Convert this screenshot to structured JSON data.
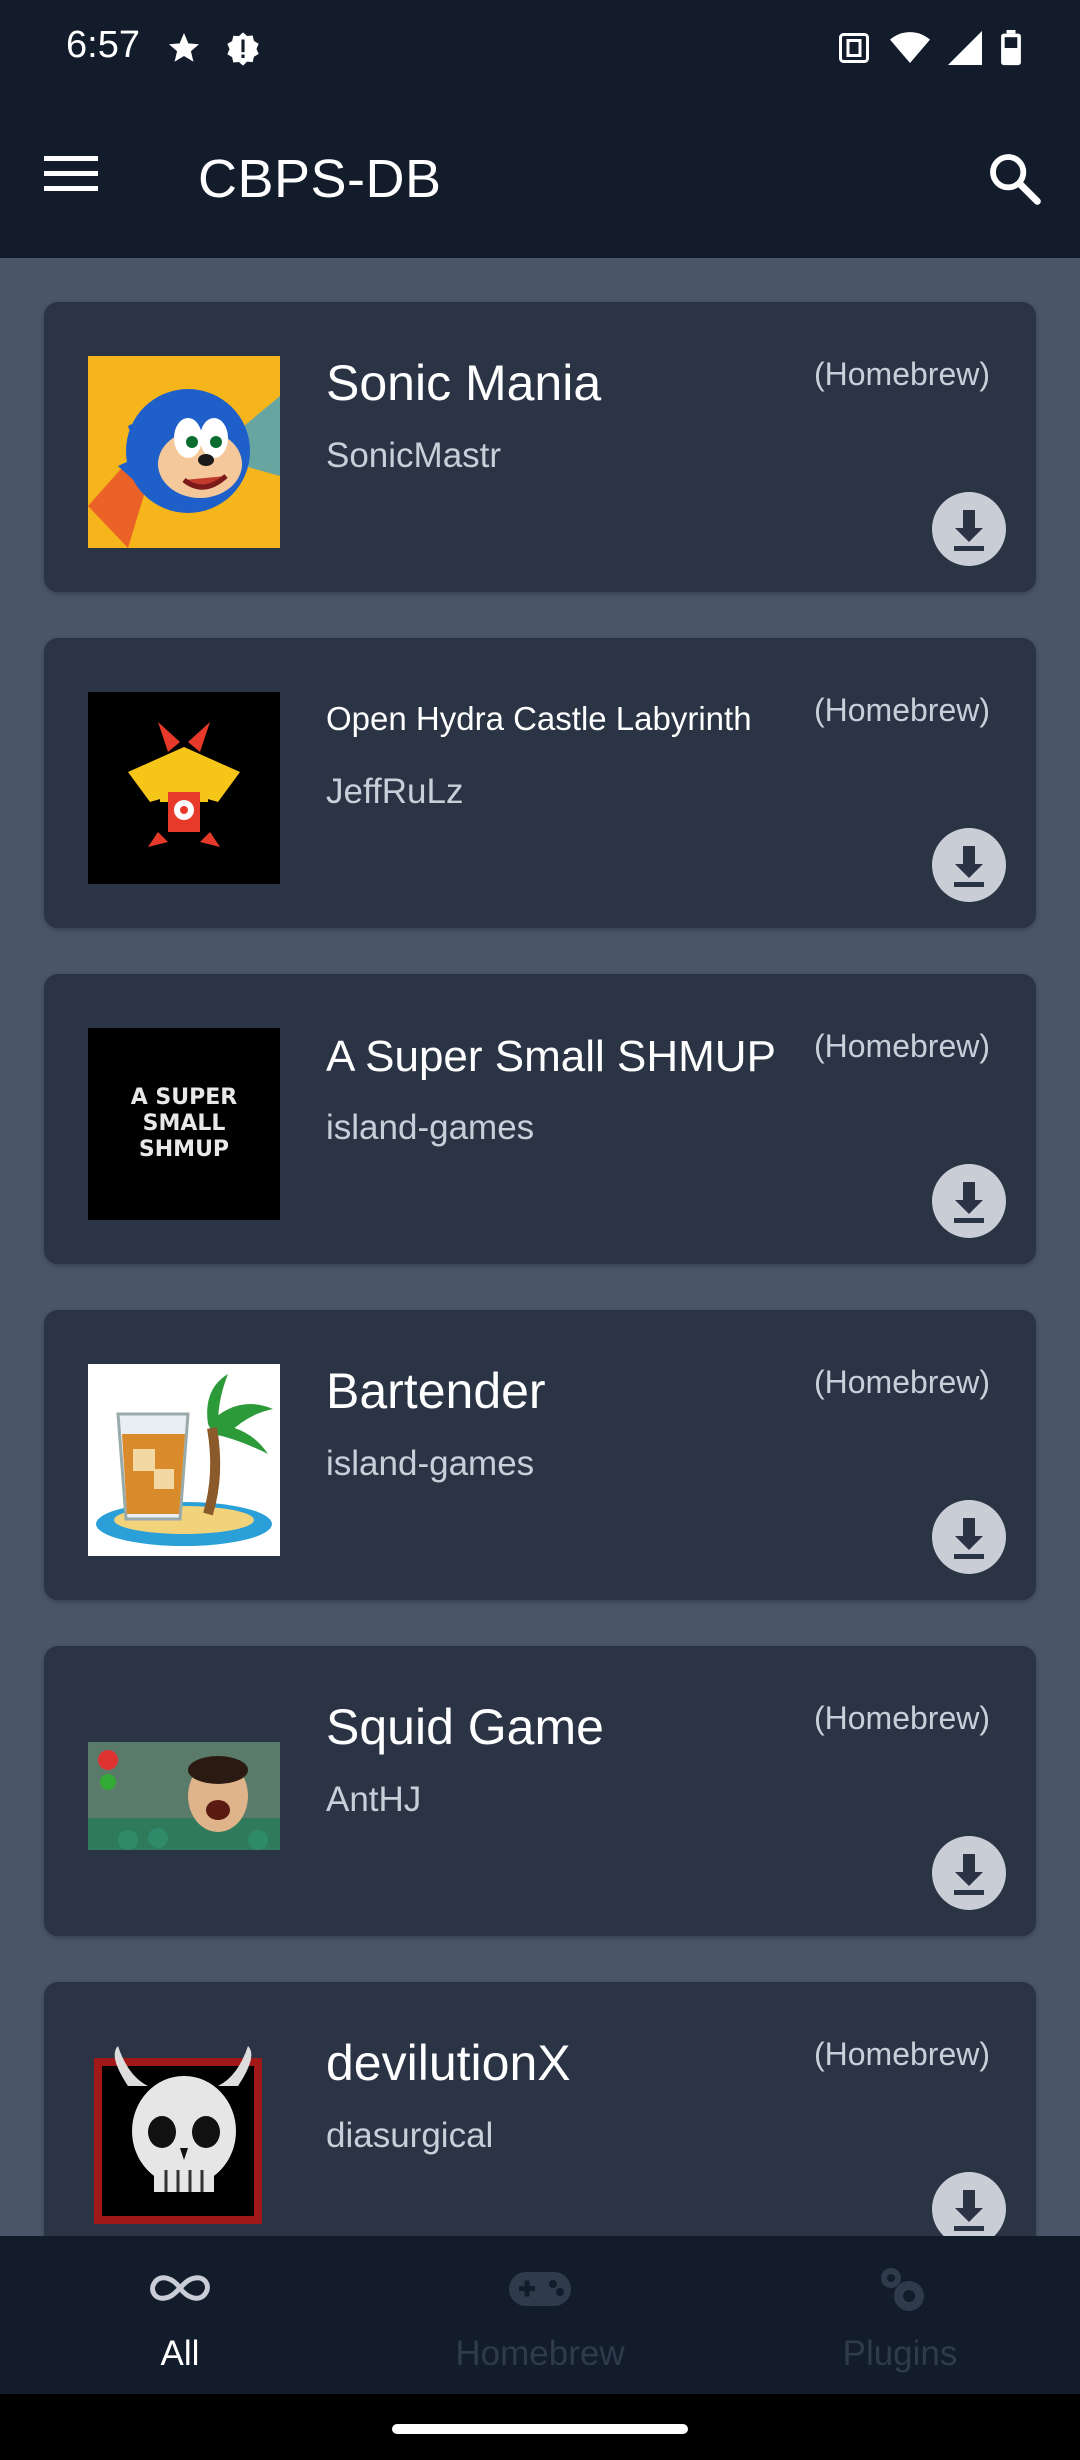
{
  "status": {
    "time": "6:57",
    "left_icons": [
      "star-icon",
      "alert-shield-icon"
    ],
    "right_icons": [
      "nfc-icon",
      "wifi-icon",
      "signal-icon",
      "battery-icon"
    ]
  },
  "app_bar": {
    "title": "CBPS-DB",
    "menu_icon": "hamburger-menu-icon",
    "search_icon": "search-icon"
  },
  "items": [
    {
      "title": "Sonic Mania",
      "author": "SonicMastr",
      "tag": "(Homebrew)"
    },
    {
      "title": "Open Hydra Castle Labyrinth",
      "author": "JeffRuLz",
      "tag": "(Homebrew)"
    },
    {
      "title": "A Super Small SHMUP",
      "author": "island-games",
      "tag": "(Homebrew)",
      "thumb_text": "A SUPER SMALL SHMUP"
    },
    {
      "title": "Bartender",
      "author": "island-games",
      "tag": "(Homebrew)"
    },
    {
      "title": "Squid Game",
      "author": "AntHJ",
      "tag": "(Homebrew)"
    },
    {
      "title": "devilutionX",
      "author": "diasurgical",
      "tag": "(Homebrew)"
    }
  ],
  "bottom_nav": [
    {
      "label": "All",
      "icon": "infinity-icon",
      "active": true
    },
    {
      "label": "Homebrew",
      "icon": "gamepad-icon",
      "active": false
    },
    {
      "label": "Plugins",
      "icon": "gear-icon",
      "active": false
    }
  ],
  "colors": {
    "app_bar": "#131c2b",
    "background": "#4a5668",
    "card": "#2a3445",
    "download_button": "#c9ced6"
  }
}
